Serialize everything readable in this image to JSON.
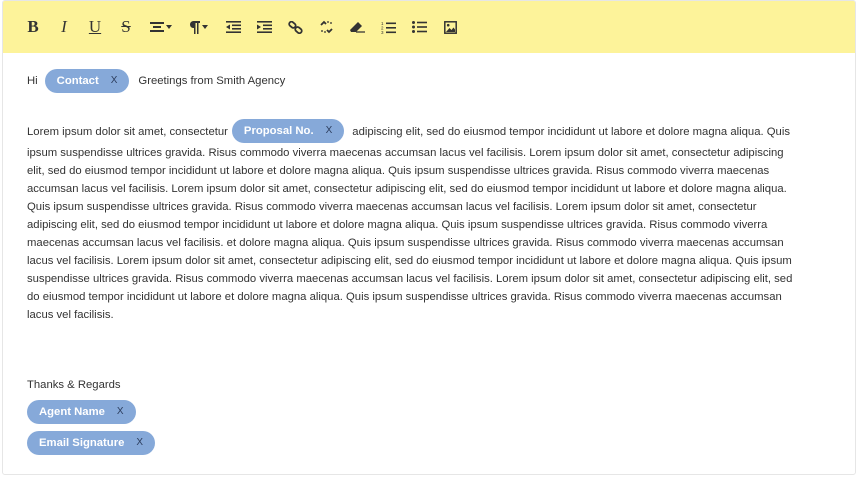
{
  "toolbar": {
    "items": [
      {
        "name": "bold",
        "glyph": "B"
      },
      {
        "name": "italic",
        "glyph": "I"
      },
      {
        "name": "underline",
        "glyph": "U"
      },
      {
        "name": "strikethrough",
        "glyph": "S"
      }
    ],
    "icons": [
      "align-icon",
      "paragraph-icon",
      "outdent-icon",
      "indent-icon",
      "link-icon",
      "unlink-icon",
      "eraser-icon",
      "ordered-list-icon",
      "unordered-list-icon",
      "image-icon"
    ],
    "background": "#fdf39a"
  },
  "greeting": {
    "prefix": "Hi",
    "token": "Contact",
    "suffix": "Greetings from Smith Agency"
  },
  "body": {
    "before_token": "Lorem ipsum dolor sit amet, consectetur",
    "token": "Proposal No.",
    "after_token": "adipiscing elit, sed do eiusmod tempor incididunt ut labore et dolore magna aliqua. Quis ipsum suspendisse ultrices gravida. Risus commodo viverra maecenas accumsan lacus vel facilisis. Lorem ipsum dolor sit amet, consectetur adipiscing elit, sed do eiusmod tempor incididunt ut labore et dolore magna aliqua. Quis ipsum suspendisse ultrices gravida. Risus commodo viverra maecenas accumsan lacus vel facilisis. Lorem ipsum dolor sit amet, consectetur adipiscing elit, sed do eiusmod tempor incididunt ut labore et dolore magna aliqua. Quis ipsum suspendisse ultrices gravida. Risus commodo viverra maecenas accumsan lacus vel facilisis. Lorem ipsum dolor sit amet, consectetur adipiscing elit, sed do eiusmod tempor incididunt ut labore et dolore magna aliqua. Quis ipsum suspendisse ultrices gravida. Risus commodo viverra maecenas accumsan lacus vel facilisis. et dolore magna aliqua. Quis ipsum suspendisse ultrices gravida. Risus commodo viverra maecenas accumsan lacus vel facilisis. Lorem ipsum dolor sit amet, consectetur adipiscing elit, sed do eiusmod tempor incididunt ut labore et dolore magna aliqua. Quis ipsum suspendisse ultrices gravida. Risus commodo viverra maecenas accumsan lacus vel facilisis. Lorem ipsum dolor sit amet, consectetur adipiscing elit, sed do eiusmod tempor incididunt ut labore et dolore magna aliqua. Quis ipsum suspendisse ultrices gravida. Risus commodo viverra maecenas accumsan lacus vel facilisis."
  },
  "closing": {
    "text": "Thanks & Regards",
    "agent_token": "Agent Name",
    "signature_token": "Email Signature"
  },
  "token_remove_label": "X",
  "token_color": "#86a9d9"
}
